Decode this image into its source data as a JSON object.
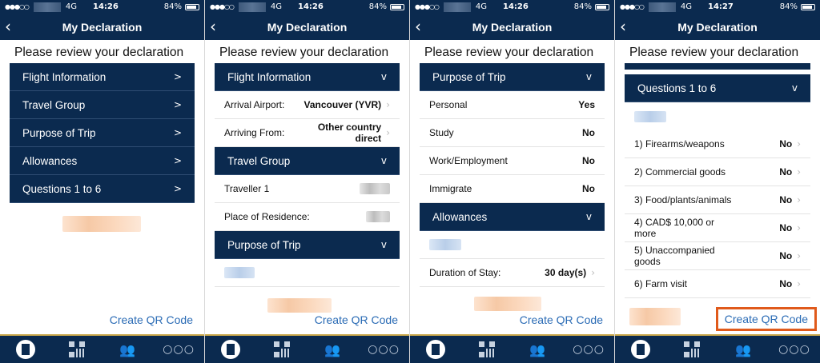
{
  "status": {
    "network": "4G",
    "battery": "84%",
    "times": [
      "14:26",
      "14:26",
      "14:26",
      "14:27"
    ]
  },
  "header": {
    "title": "My Declaration"
  },
  "review_title": "Please review your declaration",
  "qr_label": "Create QR Code",
  "panel1": {
    "sections": [
      "Flight Information",
      "Travel Group",
      "Purpose of Trip",
      "Allowances",
      "Questions 1 to 6"
    ]
  },
  "panel2": {
    "flight_header": "Flight Information",
    "arrival_label": "Arrival Airport:",
    "arrival_value": "Vancouver (YVR)",
    "from_label": "Arriving From:",
    "from_value": "Other country direct",
    "travel_header": "Travel Group",
    "traveller_label": "Traveller 1",
    "residence_label": "Place of Residence:",
    "purpose_header": "Purpose of Trip"
  },
  "panel3": {
    "purpose_header": "Purpose of Trip",
    "rows": [
      {
        "label": "Personal",
        "value": "Yes"
      },
      {
        "label": "Study",
        "value": "No"
      },
      {
        "label": "Work/Employment",
        "value": "No"
      },
      {
        "label": "Immigrate",
        "value": "No"
      }
    ],
    "allowances_header": "Allowances",
    "duration_label": "Duration of Stay:",
    "duration_value": "30 day(s)"
  },
  "panel4": {
    "questions_header": "Questions 1 to 6",
    "rows": [
      {
        "label": "1) Firearms/weapons",
        "value": "No"
      },
      {
        "label": "2) Commercial goods",
        "value": "No"
      },
      {
        "label": "3) Food/plants/animals",
        "value": "No"
      },
      {
        "label": "4) CAD$ 10,000 or more",
        "value": "No"
      },
      {
        "label": "5) Unaccompanied goods",
        "value": "No"
      },
      {
        "label": "6) Farm visit",
        "value": "No"
      }
    ]
  },
  "icons": {
    "back": "chevron-left-icon",
    "chevron_right": "chevron-right-icon",
    "chevron_down": "chevron-down-icon",
    "tabs": [
      "home-icon",
      "qr-code-icon",
      "people-icon",
      "more-icon"
    ]
  },
  "colors": {
    "navy": "#0b2a4f",
    "accent": "#c9a74a",
    "link": "#2a6bb5",
    "highlight": "#e05a1b"
  }
}
